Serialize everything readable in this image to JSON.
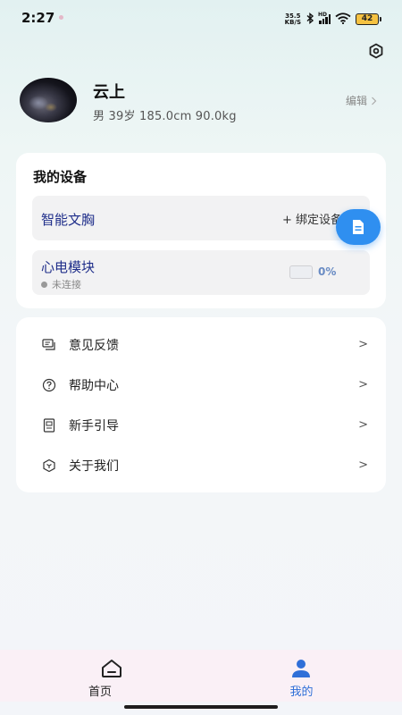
{
  "status_bar": {
    "time": "2:27",
    "net_speed_value": "35.5",
    "net_speed_unit": "KB/S",
    "signal_label": "HD",
    "battery_level": "42"
  },
  "profile": {
    "name": "云上",
    "info": "男  39岁 185.0cm 90.0kg",
    "edit_label": "编辑"
  },
  "devices": {
    "title": "我的设备",
    "bra": {
      "name": "智能文胸",
      "bind_label": "+ 绑定设备"
    },
    "ecg": {
      "name": "心电模块",
      "status": "未连接",
      "battery_percent": "0%",
      "battery_fraction": 0
    }
  },
  "menu": {
    "items": [
      {
        "label": "意见反馈",
        "icon": "feedback-icon"
      },
      {
        "label": "帮助中心",
        "icon": "help-icon"
      },
      {
        "label": "新手引导",
        "icon": "guide-icon"
      },
      {
        "label": "关于我们",
        "icon": "about-icon"
      }
    ],
    "arrow": ">"
  },
  "bottom_nav": {
    "home_label": "首页",
    "mine_label": "我的",
    "active": "mine"
  },
  "colors": {
    "accent": "#2f8ff0",
    "active_tab": "#2f6fd8",
    "device_name": "#1f2e8a"
  }
}
